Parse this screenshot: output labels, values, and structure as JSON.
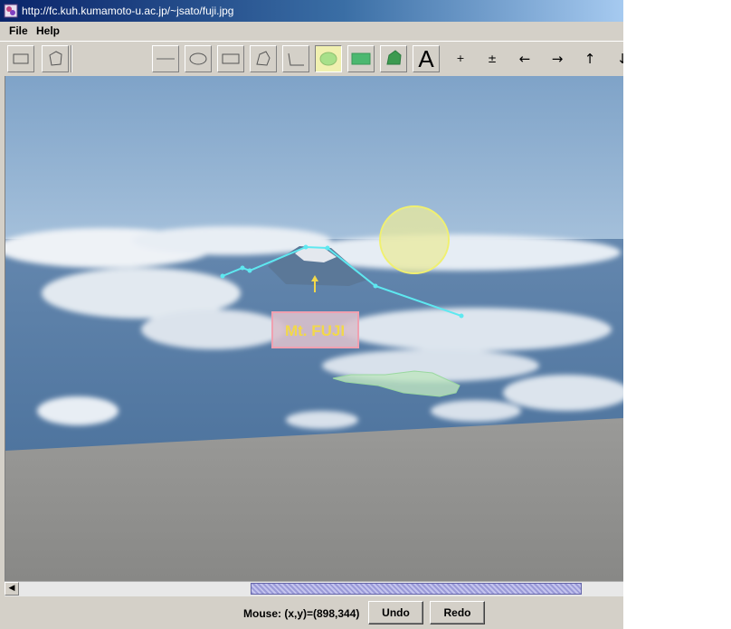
{
  "window": {
    "title": "http://fc.kuh.kumamoto-u.ac.jp/~jsato/fuji.jpg"
  },
  "menu": {
    "items": [
      "File",
      "Help"
    ]
  },
  "toolbar": {
    "tools": [
      {
        "name": "select-rectangle-tool",
        "icon": "rectangle-icon"
      },
      {
        "name": "select-polygon-tool",
        "icon": "polygon-icon"
      },
      {
        "name": "line-tool",
        "icon": "line-icon"
      },
      {
        "name": "ellipse-tool",
        "icon": "ellipse-icon"
      },
      {
        "name": "rectangle-tool",
        "icon": "rectangle-icon"
      },
      {
        "name": "polygon-tool",
        "icon": "polygon-icon"
      },
      {
        "name": "polyline-tool",
        "icon": "polyline-icon"
      },
      {
        "name": "filled-ellipse-tool",
        "icon": "filled-ellipse-icon",
        "selected": true
      },
      {
        "name": "filled-rectangle-tool",
        "icon": "filled-rectangle-icon"
      },
      {
        "name": "filled-polygon-tool",
        "icon": "filled-polygon-icon"
      }
    ],
    "text_tool_label": "A",
    "zoom_in_label": "+",
    "zoom_toggle_label": "±",
    "left_label": "←",
    "right_label": "→",
    "up_label": "↑",
    "down_label": "↓"
  },
  "annotations": {
    "label_text": "Mt. FUJI",
    "label_color": "#f2d84a",
    "line_color": "#5ee8f0",
    "circle_color": "#f0f070"
  },
  "status": {
    "mouse_label": "Mouse: (x,y)=(898,344)",
    "undo_label": "Undo",
    "redo_label": "Redo"
  },
  "colors": {
    "titlebar_start": "#0a246a",
    "selected_tool": "#f0f0b0"
  }
}
